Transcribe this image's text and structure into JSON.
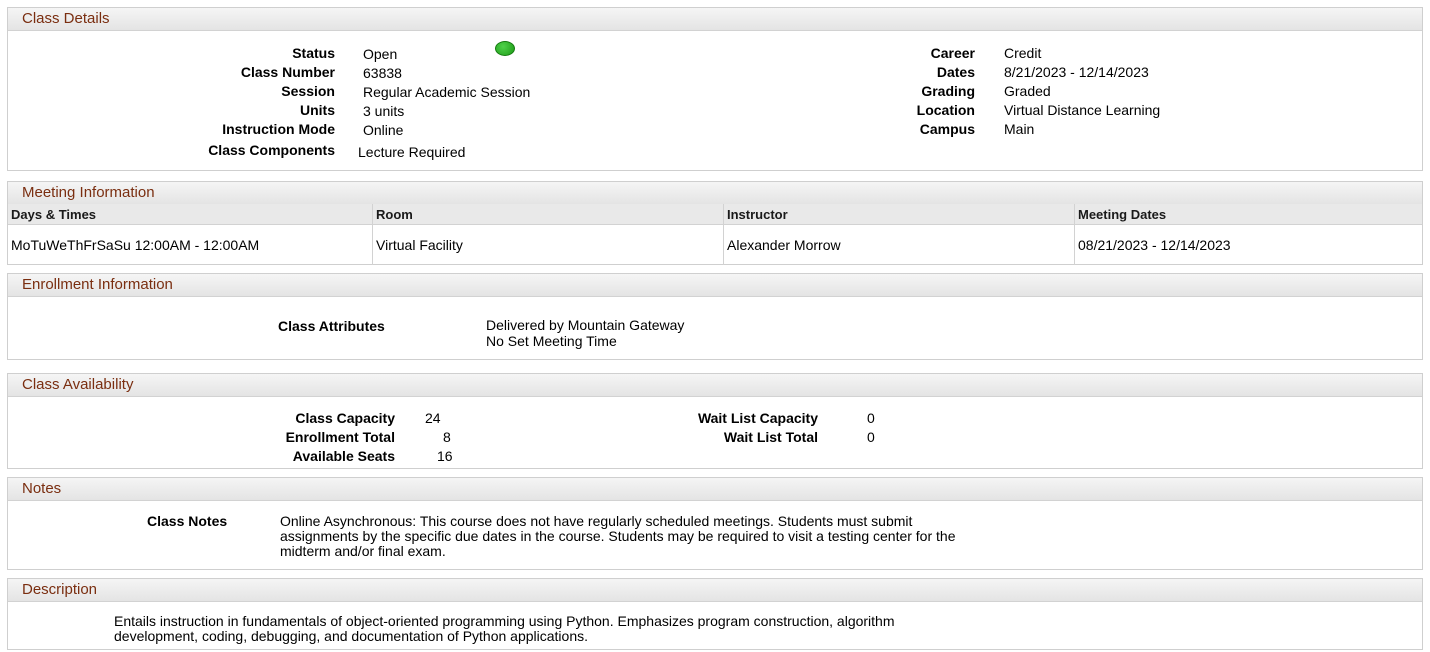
{
  "class_details": {
    "header": "Class Details",
    "left": [
      {
        "label": "Status",
        "value": "Open"
      },
      {
        "label": "Class Number",
        "value": "63838"
      },
      {
        "label": "Session",
        "value": "Regular Academic Session"
      },
      {
        "label": "Units",
        "value": "3 units"
      },
      {
        "label": "Instruction Mode",
        "value": "Online"
      },
      {
        "label": "Class Components",
        "value": "Lecture Required"
      }
    ],
    "right": [
      {
        "label": "Career",
        "value": "Credit"
      },
      {
        "label": "Dates",
        "value": "8/21/2023 - 12/14/2023"
      },
      {
        "label": "Grading",
        "value": "Graded"
      },
      {
        "label": "Location",
        "value": "Virtual Distance Learning"
      },
      {
        "label": "Campus",
        "value": "Main"
      }
    ],
    "status_icon": "green-circle-icon",
    "status_color": "#2db528"
  },
  "meeting_info": {
    "header": "Meeting Information",
    "columns": [
      "Days & Times",
      "Room",
      "Instructor",
      "Meeting Dates"
    ],
    "rows": [
      [
        "MoTuWeThFrSaSu 12:00AM - 12:00AM",
        "Virtual Facility",
        "Alexander Morrow",
        "08/21/2023 - 12/14/2023"
      ]
    ]
  },
  "enrollment_info": {
    "header": "Enrollment Information",
    "label": "Class Attributes",
    "values": [
      "Delivered by Mountain Gateway",
      "No Set Meeting Time"
    ]
  },
  "availability": {
    "header": "Class Availability",
    "left": [
      {
        "label": "Class Capacity",
        "value": "24"
      },
      {
        "label": "Enrollment Total",
        "value": "8"
      },
      {
        "label": "Available Seats",
        "value": "16"
      }
    ],
    "right": [
      {
        "label": "Wait List Capacity",
        "value": "0"
      },
      {
        "label": "Wait List Total",
        "value": "0"
      }
    ]
  },
  "notes": {
    "header": "Notes",
    "label": "Class Notes",
    "lines": [
      "Online Asynchronous: This course does not have regularly scheduled meetings.  Students must submit",
      "assignments by the specific due dates in the course.   Students may be required to visit a testing center for the",
      "midterm and/or final exam."
    ]
  },
  "description": {
    "header": "Description",
    "lines": [
      "Entails instruction in fundamentals of object-oriented programming using Python.  Emphasizes program construction, algorithm",
      "development, coding, debugging, and documentation of Python applications."
    ]
  },
  "colors": {
    "header_text": "#7a2e10",
    "header_bg": "#e9e9e9",
    "border": "#cfcfcf"
  }
}
